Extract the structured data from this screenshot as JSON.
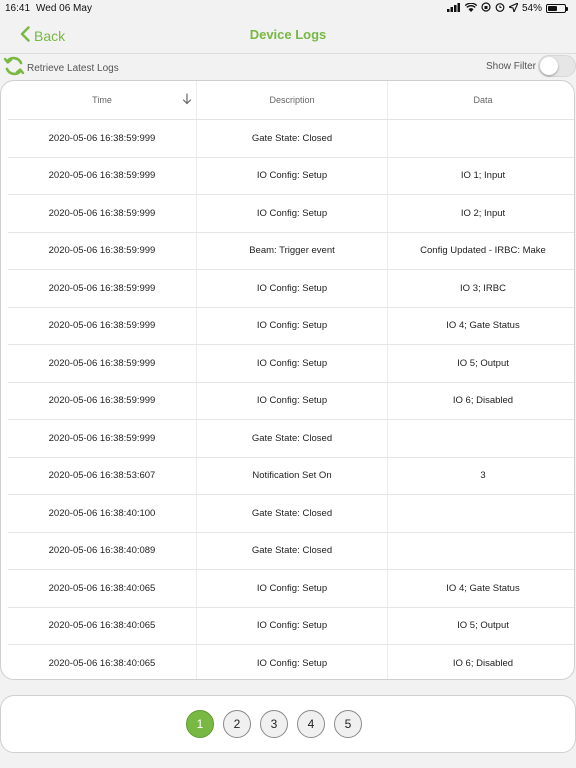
{
  "status_bar": {
    "time": "16:41",
    "date": "Wed 06 May",
    "battery": "54%",
    "battery_level": 0.54,
    "icons": [
      "signal-icon",
      "wifi-icon",
      "orientation-lock-icon",
      "alarm-icon",
      "location-icon",
      "battery-icon"
    ]
  },
  "nav": {
    "back_label": "Back",
    "title": "Device Logs",
    "accent_color": "#78b843"
  },
  "toolbar": {
    "retrieve_label": "Retrieve Latest Logs",
    "show_filter_label": "Show Filter",
    "show_filter_on": false
  },
  "table": {
    "columns": [
      "Time",
      "Description",
      "Data"
    ],
    "sort_column": "Time",
    "sort_direction": "descending",
    "rows": [
      {
        "time": "2020-05-06 16:38:59:999",
        "description": "Gate State: Closed",
        "data": ""
      },
      {
        "time": "2020-05-06 16:38:59:999",
        "description": "IO Config: Setup",
        "data": "IO 1; Input"
      },
      {
        "time": "2020-05-06 16:38:59:999",
        "description": "IO Config: Setup",
        "data": "IO 2; Input"
      },
      {
        "time": "2020-05-06 16:38:59:999",
        "description": "Beam: Trigger event",
        "data": "Config Updated - IRBC: Make"
      },
      {
        "time": "2020-05-06 16:38:59:999",
        "description": "IO Config: Setup",
        "data": "IO 3; IRBC"
      },
      {
        "time": "2020-05-06 16:38:59:999",
        "description": "IO Config: Setup",
        "data": "IO 4; Gate Status"
      },
      {
        "time": "2020-05-06 16:38:59:999",
        "description": "IO Config: Setup",
        "data": "IO 5; Output"
      },
      {
        "time": "2020-05-06 16:38:59:999",
        "description": "IO Config: Setup",
        "data": "IO 6; Disabled"
      },
      {
        "time": "2020-05-06 16:38:59:999",
        "description": "Gate State: Closed",
        "data": ""
      },
      {
        "time": "2020-05-06 16:38:53:607",
        "description": "Notification Set On",
        "data": "3"
      },
      {
        "time": "2020-05-06 16:38:40:100",
        "description": "Gate State: Closed",
        "data": ""
      },
      {
        "time": "2020-05-06 16:38:40:089",
        "description": "Gate State: Closed",
        "data": ""
      },
      {
        "time": "2020-05-06 16:38:40:065",
        "description": "IO Config: Setup",
        "data": "IO 4; Gate Status"
      },
      {
        "time": "2020-05-06 16:38:40:065",
        "description": "IO Config: Setup",
        "data": "IO 5; Output"
      },
      {
        "time": "2020-05-06 16:38:40:065",
        "description": "IO Config: Setup",
        "data": "IO 6; Disabled"
      }
    ]
  },
  "pagination": {
    "pages": [
      "1",
      "2",
      "3",
      "4",
      "5"
    ],
    "current": "1"
  }
}
